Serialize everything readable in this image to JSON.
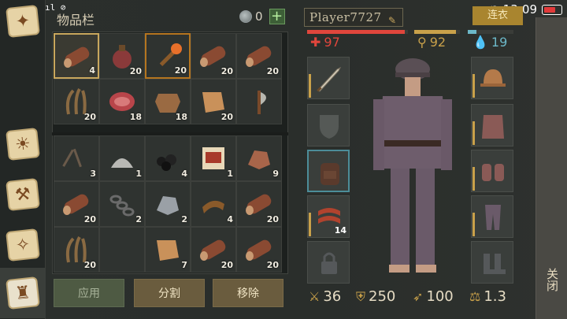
{
  "status_bar": {
    "left_text": "1 .ıl 2 ıl ⊘",
    "time": "13:09"
  },
  "header": {
    "title": "物品栏",
    "currency": "0",
    "plus": "+"
  },
  "inventory": {
    "items": [
      {
        "icon": "log-icon",
        "count": "4"
      },
      {
        "icon": "flask-icon",
        "count": "20"
      },
      {
        "icon": "torch-icon",
        "count": "20"
      },
      {
        "icon": "log-icon",
        "count": "20"
      },
      {
        "icon": "log-icon",
        "count": "20"
      },
      {
        "icon": "fiber-icon",
        "count": "20"
      },
      {
        "icon": "meat-icon",
        "count": "18"
      },
      {
        "icon": "hide-icon",
        "count": "18"
      },
      {
        "icon": "leather-icon",
        "count": "20"
      },
      {
        "icon": "axe-icon",
        "count": ""
      },
      {
        "icon": "nails-icon",
        "count": "3"
      },
      {
        "icon": "dust-icon",
        "count": "1"
      },
      {
        "icon": "coal-icon",
        "count": "4"
      },
      {
        "icon": "recipe-scroll-icon",
        "count": "1"
      },
      {
        "icon": "copper-ore-icon",
        "count": "9"
      },
      {
        "icon": "log-icon",
        "count": "20"
      },
      {
        "icon": "chain-icon",
        "count": "2"
      },
      {
        "icon": "iron-ore-icon",
        "count": "2"
      },
      {
        "icon": "leather-strip-icon",
        "count": "4"
      },
      {
        "icon": "log-icon",
        "count": "20"
      },
      {
        "icon": "fiber-icon",
        "count": "20"
      },
      {
        "icon": "empty-icon",
        "count": ""
      },
      {
        "icon": "leather-icon",
        "count": "7"
      },
      {
        "icon": "log-icon",
        "count": "20"
      },
      {
        "icon": "log-icon",
        "count": "20"
      }
    ]
  },
  "buttons": {
    "apply": "应用",
    "split": "分割",
    "remove": "移除"
  },
  "player": {
    "name": "Player7727",
    "health": "97",
    "health_fraction": 0.97,
    "food": "92",
    "food_fraction": 0.92,
    "water": "19",
    "water_fraction": 0.19,
    "tag": "连衣"
  },
  "equipment": {
    "meat_count": "14"
  },
  "bottom_stats": {
    "attack": "36",
    "armor": "250",
    "speed": "100",
    "weight": "1.3"
  },
  "close_label": "关闭",
  "colors": {
    "health": "#e0463c",
    "food": "#c9a14a",
    "water": "#6cb8c8"
  }
}
